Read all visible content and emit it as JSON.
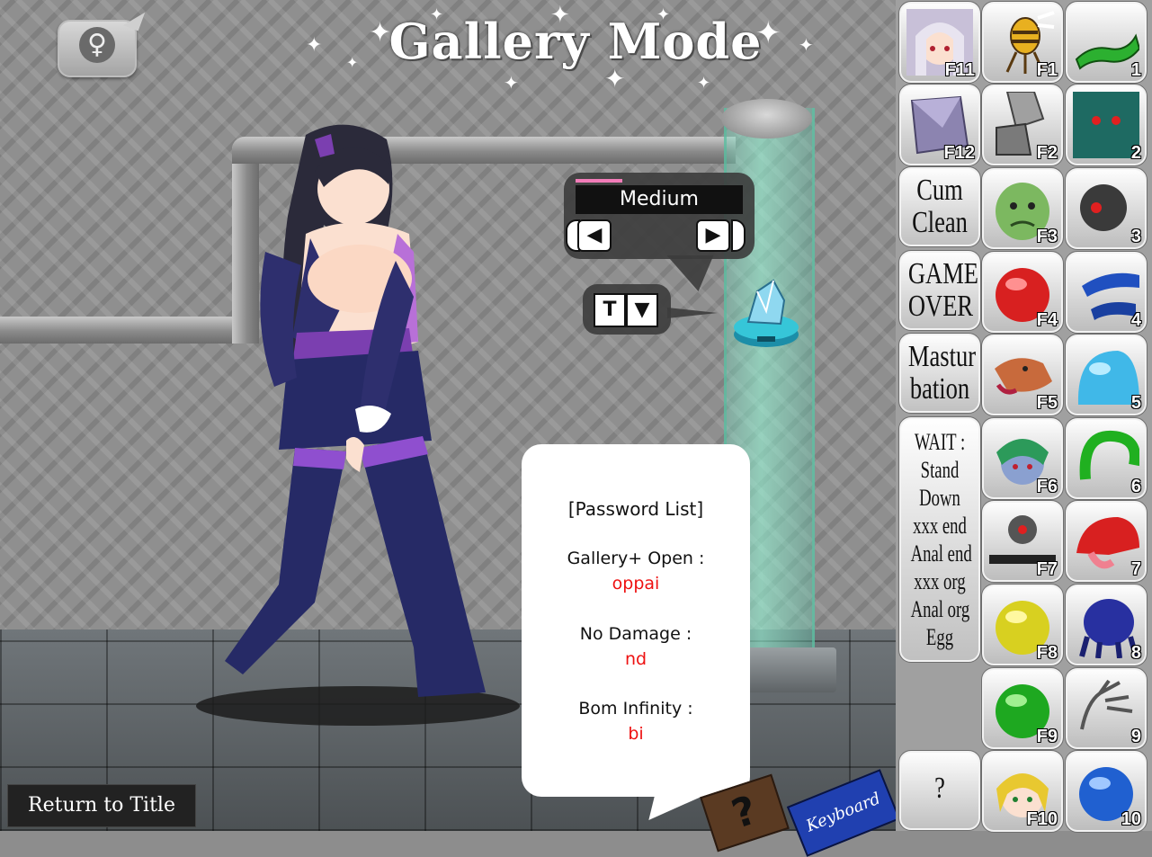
{
  "title": "Gallery Mode",
  "gender_symbol": "♀",
  "difficulty": {
    "label": "Medium",
    "prev_glyph": "◀",
    "next_glyph": "▶"
  },
  "clothing_toggles": {
    "top_glyph": "T",
    "bottom_glyph": "▼"
  },
  "password_card": {
    "title": "[Password List]",
    "entries": [
      {
        "label": "Gallery+ Open :",
        "value": "oppai"
      },
      {
        "label": "No Damage :",
        "value": "nd"
      },
      {
        "label": "Bom Infinity :",
        "value": "bi"
      }
    ]
  },
  "help_book": {
    "glyph": "?"
  },
  "keyboard_book": {
    "label": "Keyboard"
  },
  "return_label": "Return to Title",
  "panel": {
    "col1": {
      "tiles": [
        {
          "key": "F11",
          "icon": "silver-hair-girl-portrait"
        },
        {
          "key": "F12",
          "icon": "glass-block"
        }
      ],
      "text_tiles": [
        {
          "lines": [
            "Cum",
            "Clean"
          ]
        },
        {
          "lines": [
            "GAME",
            "OVER"
          ]
        },
        {
          "lines": [
            "Mastur",
            "bation"
          ]
        }
      ],
      "wait_lines": [
        "WAIT :",
        "Stand",
        "Down",
        "xxx end",
        "Anal end",
        "xxx org",
        "Anal org",
        "Egg"
      ],
      "help_tile": "?"
    },
    "col2": [
      {
        "key": "F1",
        "icon": "wasp-monster"
      },
      {
        "key": "F2",
        "icon": "robot-arm"
      },
      {
        "key": "F3",
        "icon": "green-orc-face"
      },
      {
        "key": "F4",
        "icon": "red-slime-ball"
      },
      {
        "key": "F5",
        "icon": "dog-head"
      },
      {
        "key": "F6",
        "icon": "green-hair-girl-portrait"
      },
      {
        "key": "F7",
        "icon": "eye-drone"
      },
      {
        "key": "F8",
        "icon": "yellow-slime-ball"
      },
      {
        "key": "F9",
        "icon": "green-slime-ball"
      },
      {
        "key": "F10",
        "icon": "blonde-girl-portrait"
      }
    ],
    "col3": [
      {
        "key": "1",
        "icon": "green-tentacle"
      },
      {
        "key": "2",
        "icon": "green-zombie-face"
      },
      {
        "key": "3",
        "icon": "red-eye-robot"
      },
      {
        "key": "4",
        "icon": "blue-tentacle"
      },
      {
        "key": "5",
        "icon": "blue-slime-blob"
      },
      {
        "key": "6",
        "icon": "green-loop-tentacle"
      },
      {
        "key": "7",
        "icon": "red-tongue-monster"
      },
      {
        "key": "8",
        "icon": "navy-blob-monster"
      },
      {
        "key": "9",
        "icon": "ghost-hand"
      },
      {
        "key": "10",
        "icon": "blue-slime-ball"
      }
    ]
  },
  "colors": {
    "accent_pink": "#f27cb8",
    "password_value": "#e11111",
    "tube_green": "#8ef0cf"
  }
}
